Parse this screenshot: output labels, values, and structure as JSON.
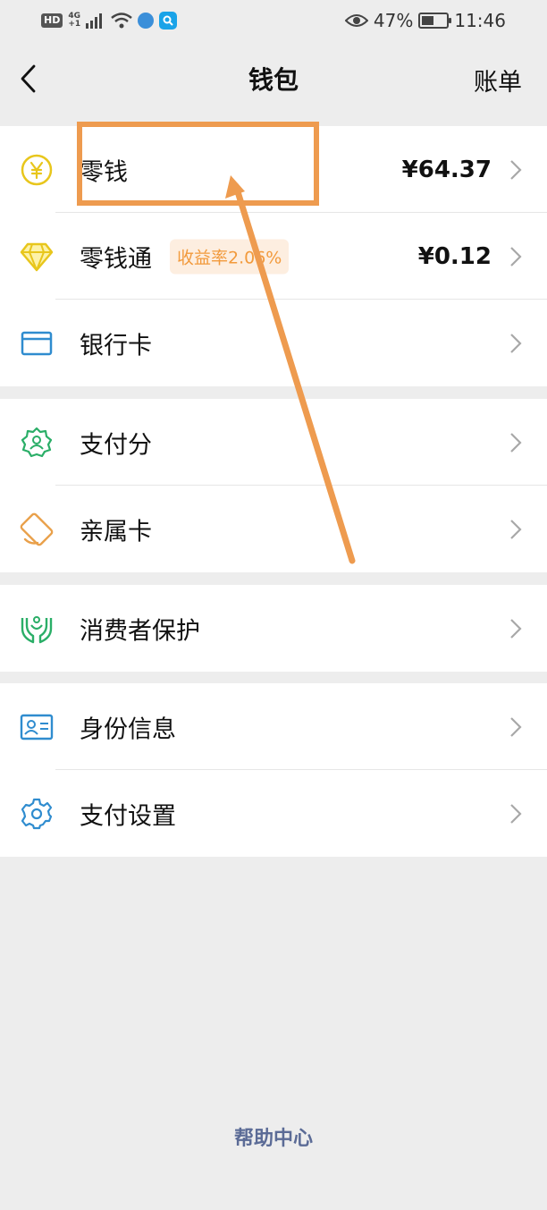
{
  "status_bar": {
    "hd": "HD",
    "network": "4G",
    "network_sub": "+1",
    "battery_percent": "47%",
    "battery_level": 0.47,
    "time": "11:46"
  },
  "nav": {
    "title": "钱包",
    "right_action": "账单"
  },
  "groups": [
    {
      "items": [
        {
          "label": "零钱",
          "value": "¥64.37",
          "icon": "yuan-coin-icon"
        },
        {
          "label": "零钱通",
          "badge": "收益率2.06%",
          "value": "¥0.12",
          "icon": "diamond-icon"
        },
        {
          "label": "银行卡",
          "icon": "bank-card-icon"
        }
      ]
    },
    {
      "items": [
        {
          "label": "支付分",
          "icon": "pay-score-icon"
        },
        {
          "label": "亲属卡",
          "icon": "family-card-icon"
        }
      ]
    },
    {
      "items": [
        {
          "label": "消费者保护",
          "icon": "consumer-protection-icon"
        }
      ]
    },
    {
      "items": [
        {
          "label": "身份信息",
          "icon": "id-card-icon"
        },
        {
          "label": "支付设置",
          "icon": "settings-gear-icon"
        }
      ]
    }
  ],
  "footer": {
    "help": "帮助中心"
  },
  "colors": {
    "background": "#ededed",
    "accent_yellow": "#e8c61c",
    "accent_green": "#2aae67",
    "accent_blue": "#2f8ccf",
    "accent_orange": "#e9a04a",
    "annotation": "#ee9b4f",
    "link": "#5b6b96"
  }
}
